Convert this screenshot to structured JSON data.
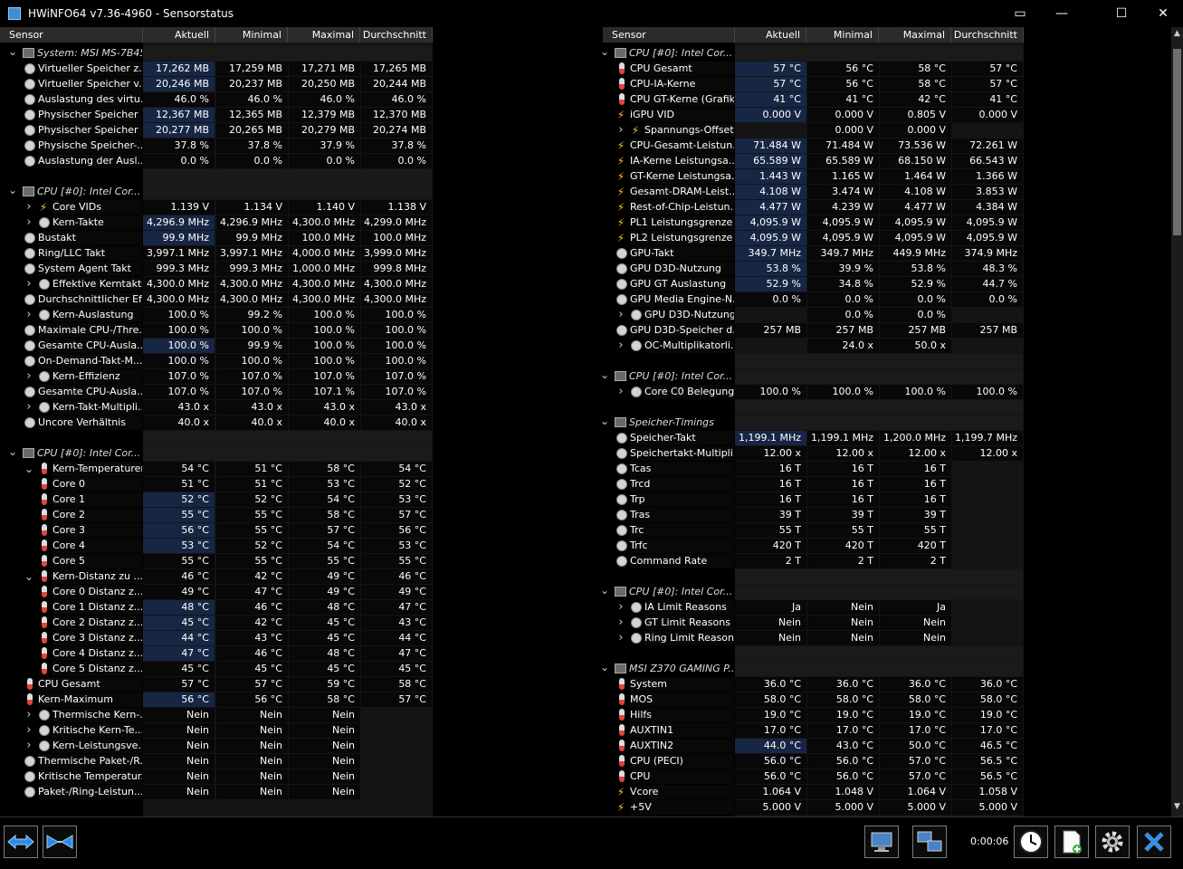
{
  "window": {
    "title": "HWiNFO64 v7.36-4960 - Sensorstatus",
    "min": "—",
    "max": "☐",
    "close": "✕"
  },
  "columns": {
    "sensor": "Sensor",
    "current": "Aktuell",
    "min": "Minimal",
    "max": "Maximal",
    "avg": "Durchschnitt"
  },
  "left": [
    {
      "t": "g",
      "n": "System: MSI MS-7B45",
      "i": "chip"
    },
    {
      "n": "Virtueller Speicher z...",
      "i": "clock",
      "v": [
        "17,262 MB",
        "17,259 MB",
        "17,271 MB",
        "17,265 MB"
      ],
      "h": 1
    },
    {
      "n": "Virtueller Speicher v...",
      "i": "clock",
      "v": [
        "20,246 MB",
        "20,237 MB",
        "20,250 MB",
        "20,244 MB"
      ],
      "h": 1
    },
    {
      "n": "Auslastung des virtu...",
      "i": "clock",
      "v": [
        "46.0 %",
        "46.0 %",
        "46.0 %",
        "46.0 %"
      ]
    },
    {
      "n": "Physischer Speicher ...",
      "i": "clock",
      "v": [
        "12,367 MB",
        "12,365 MB",
        "12,379 MB",
        "12,370 MB"
      ],
      "h": 1
    },
    {
      "n": "Physischer Speicher ...",
      "i": "clock",
      "v": [
        "20,277 MB",
        "20,265 MB",
        "20,279 MB",
        "20,274 MB"
      ],
      "h": 1
    },
    {
      "n": "Physische Speicher-...",
      "i": "clock",
      "v": [
        "37.8 %",
        "37.8 %",
        "37.9 %",
        "37.8 %"
      ]
    },
    {
      "n": "Auslastung der Ausl...",
      "i": "clock",
      "v": [
        "0.0 %",
        "0.0 %",
        "0.0 %",
        "0.0 %"
      ]
    },
    {
      "t": "b"
    },
    {
      "t": "g",
      "n": "CPU [#0]: Intel Cor...",
      "i": "chip"
    },
    {
      "n": "Core VIDs",
      "i": "bolt",
      "x": 1,
      "v": [
        "1.139 V",
        "1.134 V",
        "1.140 V",
        "1.138 V"
      ]
    },
    {
      "n": "Kern-Takte",
      "i": "clock",
      "x": 1,
      "v": [
        "4,296.9 MHz",
        "4,296.9 MHz",
        "4,300.0 MHz",
        "4,299.0 MHz"
      ],
      "h": 1
    },
    {
      "n": "Bustakt",
      "i": "clock",
      "v": [
        "99.9 MHz",
        "99.9 MHz",
        "100.0 MHz",
        "100.0 MHz"
      ],
      "h": 1
    },
    {
      "n": "Ring/LLC Takt",
      "i": "clock",
      "v": [
        "3,997.1 MHz",
        "3,997.1 MHz",
        "4,000.0 MHz",
        "3,999.0 MHz"
      ]
    },
    {
      "n": "System Agent Takt",
      "i": "clock",
      "v": [
        "999.3 MHz",
        "999.3 MHz",
        "1,000.0 MHz",
        "999.8 MHz"
      ]
    },
    {
      "n": "Effektive Kerntakte",
      "i": "clock",
      "x": 1,
      "v": [
        "4,300.0 MHz",
        "4,300.0 MHz",
        "4,300.0 MHz",
        "4,300.0 MHz"
      ]
    },
    {
      "n": "Durchschnittlicher Ef...",
      "i": "clock",
      "v": [
        "4,300.0 MHz",
        "4,300.0 MHz",
        "4,300.0 MHz",
        "4,300.0 MHz"
      ]
    },
    {
      "n": "Kern-Auslastung",
      "i": "clock",
      "x": 1,
      "v": [
        "100.0 %",
        "99.2 %",
        "100.0 %",
        "100.0 %"
      ]
    },
    {
      "n": "Maximale CPU-/Thre...",
      "i": "clock",
      "v": [
        "100.0 %",
        "100.0 %",
        "100.0 %",
        "100.0 %"
      ]
    },
    {
      "n": "Gesamte CPU-Ausla...",
      "i": "clock",
      "v": [
        "100.0 %",
        "99.9 %",
        "100.0 %",
        "100.0 %"
      ],
      "h": 1
    },
    {
      "n": "On-Demand-Takt-M...",
      "i": "clock",
      "v": [
        "100.0 %",
        "100.0 %",
        "100.0 %",
        "100.0 %"
      ]
    },
    {
      "n": "Kern-Effizienz",
      "i": "clock",
      "x": 1,
      "v": [
        "107.0 %",
        "107.0 %",
        "107.0 %",
        "107.0 %"
      ]
    },
    {
      "n": "Gesamte CPU-Ausla...",
      "i": "clock",
      "v": [
        "107.0 %",
        "107.0 %",
        "107.1 %",
        "107.0 %"
      ]
    },
    {
      "n": "Kern-Takt-Multipli...",
      "i": "clock",
      "x": 1,
      "v": [
        "43.0 x",
        "43.0 x",
        "43.0 x",
        "43.0 x"
      ]
    },
    {
      "n": "Uncore Verhältnis",
      "i": "clock",
      "v": [
        "40.0 x",
        "40.0 x",
        "40.0 x",
        "40.0 x"
      ]
    },
    {
      "t": "b"
    },
    {
      "t": "g",
      "n": "CPU [#0]: Intel Cor...",
      "i": "chip"
    },
    {
      "n": "Kern-Temperaturen",
      "i": "therm",
      "x": 2,
      "v": [
        "54 °C",
        "51 °C",
        "58 °C",
        "54 °C"
      ]
    },
    {
      "n": "Core 0",
      "i": "therm",
      "s": 1,
      "v": [
        "51 °C",
        "51 °C",
        "53 °C",
        "52 °C"
      ]
    },
    {
      "n": "Core 1",
      "i": "therm",
      "s": 1,
      "v": [
        "52 °C",
        "52 °C",
        "54 °C",
        "53 °C"
      ],
      "h": 1
    },
    {
      "n": "Core 2",
      "i": "therm",
      "s": 1,
      "v": [
        "55 °C",
        "55 °C",
        "58 °C",
        "57 °C"
      ],
      "h": 1
    },
    {
      "n": "Core 3",
      "i": "therm",
      "s": 1,
      "v": [
        "56 °C",
        "55 °C",
        "57 °C",
        "56 °C"
      ],
      "h": 1
    },
    {
      "n": "Core 4",
      "i": "therm",
      "s": 1,
      "v": [
        "53 °C",
        "52 °C",
        "54 °C",
        "53 °C"
      ],
      "h": 1
    },
    {
      "n": "Core 5",
      "i": "therm",
      "s": 1,
      "v": [
        "55 °C",
        "55 °C",
        "55 °C",
        "55 °C"
      ]
    },
    {
      "n": "Kern-Distanz zu ...",
      "i": "therm",
      "x": 2,
      "v": [
        "46 °C",
        "42 °C",
        "49 °C",
        "46 °C"
      ]
    },
    {
      "n": "Core 0 Distanz z...",
      "i": "therm",
      "s": 1,
      "v": [
        "49 °C",
        "47 °C",
        "49 °C",
        "49 °C"
      ]
    },
    {
      "n": "Core 1 Distanz z...",
      "i": "therm",
      "s": 1,
      "v": [
        "48 °C",
        "46 °C",
        "48 °C",
        "47 °C"
      ],
      "h": 1
    },
    {
      "n": "Core 2 Distanz z...",
      "i": "therm",
      "s": 1,
      "v": [
        "45 °C",
        "42 °C",
        "45 °C",
        "43 °C"
      ],
      "h": 1
    },
    {
      "n": "Core 3 Distanz z...",
      "i": "therm",
      "s": 1,
      "v": [
        "44 °C",
        "43 °C",
        "45 °C",
        "44 °C"
      ],
      "h": 1
    },
    {
      "n": "Core 4 Distanz z...",
      "i": "therm",
      "s": 1,
      "v": [
        "47 °C",
        "46 °C",
        "48 °C",
        "47 °C"
      ],
      "h": 1
    },
    {
      "n": "Core 5 Distanz z...",
      "i": "therm",
      "s": 1,
      "v": [
        "45 °C",
        "45 °C",
        "45 °C",
        "45 °C"
      ]
    },
    {
      "n": "CPU Gesamt",
      "i": "therm",
      "v": [
        "57 °C",
        "57 °C",
        "59 °C",
        "58 °C"
      ]
    },
    {
      "n": "Kern-Maximum",
      "i": "therm",
      "v": [
        "56 °C",
        "56 °C",
        "58 °C",
        "57 °C"
      ],
      "h": 1
    },
    {
      "n": "Thermische Kern-...",
      "i": "clock",
      "x": 1,
      "v": [
        "Nein",
        "Nein",
        "Nein",
        ""
      ]
    },
    {
      "n": "Kritische Kern-Te...",
      "i": "clock",
      "x": 1,
      "v": [
        "Nein",
        "Nein",
        "Nein",
        ""
      ]
    },
    {
      "n": "Kern-Leistungsve...",
      "i": "clock",
      "x": 1,
      "v": [
        "Nein",
        "Nein",
        "Nein",
        ""
      ]
    },
    {
      "n": "Thermische Paket-/R...",
      "i": "clock",
      "v": [
        "Nein",
        "Nein",
        "Nein",
        ""
      ]
    },
    {
      "n": "Kritische Temperatur...",
      "i": "clock",
      "v": [
        "Nein",
        "Nein",
        "Nein",
        ""
      ]
    },
    {
      "n": "Paket-/Ring-Leistun...",
      "i": "clock",
      "v": [
        "Nein",
        "Nein",
        "Nein",
        ""
      ]
    }
  ],
  "right": [
    {
      "t": "g",
      "n": "CPU [#0]: Intel Cor...",
      "i": "chip"
    },
    {
      "n": "CPU Gesamt",
      "i": "therm",
      "v": [
        "57 °C",
        "56 °C",
        "58 °C",
        "57 °C"
      ],
      "h": 1
    },
    {
      "n": "CPU-IA-Kerne",
      "i": "therm",
      "v": [
        "57 °C",
        "56 °C",
        "58 °C",
        "57 °C"
      ],
      "h": 1
    },
    {
      "n": "CPU GT-Kerne (Grafik)",
      "i": "therm",
      "v": [
        "41 °C",
        "41 °C",
        "42 °C",
        "41 °C"
      ],
      "h": 1
    },
    {
      "n": "iGPU VID",
      "i": "bolt",
      "v": [
        "0.000 V",
        "0.000 V",
        "0.805 V",
        "0.000 V"
      ],
      "h": 1
    },
    {
      "n": "Spannungs-Offsets",
      "i": "bolt",
      "x": 1,
      "v": [
        "",
        "0.000 V",
        "0.000 V",
        ""
      ]
    },
    {
      "n": "CPU-Gesamt-Leistun...",
      "i": "bolt",
      "v": [
        "71.484 W",
        "71.484 W",
        "73.536 W",
        "72.261 W"
      ],
      "h": 1
    },
    {
      "n": "IA-Kerne Leistungsa...",
      "i": "bolt",
      "v": [
        "65.589 W",
        "65.589 W",
        "68.150 W",
        "66.543 W"
      ],
      "h": 1
    },
    {
      "n": "GT-Kerne Leistungsa...",
      "i": "bolt",
      "v": [
        "1.443 W",
        "1.165 W",
        "1.464 W",
        "1.366 W"
      ],
      "h": 1
    },
    {
      "n": "Gesamt-DRAM-Leist...",
      "i": "bolt",
      "v": [
        "4.108 W",
        "3.474 W",
        "4.108 W",
        "3.853 W"
      ],
      "h": 1
    },
    {
      "n": "Rest-of-Chip-Leistun...",
      "i": "bolt",
      "v": [
        "4.477 W",
        "4.239 W",
        "4.477 W",
        "4.384 W"
      ],
      "h": 1
    },
    {
      "n": "PL1 Leistungsgrenze",
      "i": "bolt",
      "v": [
        "4,095.9 W",
        "4,095.9 W",
        "4,095.9 W",
        "4,095.9 W"
      ],
      "h": 1
    },
    {
      "n": "PL2 Leistungsgrenze",
      "i": "bolt",
      "v": [
        "4,095.9 W",
        "4,095.9 W",
        "4,095.9 W",
        "4,095.9 W"
      ],
      "h": 1
    },
    {
      "n": "GPU-Takt",
      "i": "clock",
      "v": [
        "349.7 MHz",
        "349.7 MHz",
        "449.9 MHz",
        "374.9 MHz"
      ],
      "h": 1
    },
    {
      "n": "GPU D3D-Nutzung",
      "i": "clock",
      "v": [
        "53.8 %",
        "39.9 %",
        "53.8 %",
        "48.3 %"
      ],
      "h": 1
    },
    {
      "n": "GPU GT Auslastung",
      "i": "clock",
      "v": [
        "52.9 %",
        "34.8 %",
        "52.9 %",
        "44.7 %"
      ],
      "h": 1
    },
    {
      "n": "GPU Media Engine-N...",
      "i": "clock",
      "v": [
        "0.0 %",
        "0.0 %",
        "0.0 %",
        "0.0 %"
      ]
    },
    {
      "n": "GPU D3D-Nutzung",
      "i": "clock",
      "x": 1,
      "v": [
        "",
        "0.0 %",
        "0.0 %",
        ""
      ]
    },
    {
      "n": "GPU D3D-Speicher d...",
      "i": "clock",
      "v": [
        "257 MB",
        "257 MB",
        "257 MB",
        "257 MB"
      ]
    },
    {
      "n": "OC-Multiplikatorli...",
      "i": "clock",
      "x": 1,
      "v": [
        "",
        "24.0 x",
        "50.0 x",
        ""
      ]
    },
    {
      "t": "b"
    },
    {
      "t": "g",
      "n": "CPU [#0]: Intel Cor...",
      "i": "chip"
    },
    {
      "n": "Core C0 Belegung",
      "i": "clock",
      "x": 1,
      "v": [
        "100.0 %",
        "100.0 %",
        "100.0 %",
        "100.0 %"
      ]
    },
    {
      "t": "b"
    },
    {
      "t": "g",
      "n": "Speicher-Timings",
      "i": "chip"
    },
    {
      "n": "Speicher-Takt",
      "i": "clock",
      "v": [
        "1,199.1 MHz",
        "1,199.1 MHz",
        "1,200.0 MHz",
        "1,199.7 MHz"
      ],
      "h": 1
    },
    {
      "n": "Speichertakt-Multipli...",
      "i": "clock",
      "v": [
        "12.00 x",
        "12.00 x",
        "12.00 x",
        "12.00 x"
      ]
    },
    {
      "n": "Tcas",
      "i": "clock",
      "v": [
        "16 T",
        "16 T",
        "16 T",
        ""
      ]
    },
    {
      "n": "Trcd",
      "i": "clock",
      "v": [
        "16 T",
        "16 T",
        "16 T",
        ""
      ]
    },
    {
      "n": "Trp",
      "i": "clock",
      "v": [
        "16 T",
        "16 T",
        "16 T",
        ""
      ]
    },
    {
      "n": "Tras",
      "i": "clock",
      "v": [
        "39 T",
        "39 T",
        "39 T",
        ""
      ]
    },
    {
      "n": "Trc",
      "i": "clock",
      "v": [
        "55 T",
        "55 T",
        "55 T",
        ""
      ]
    },
    {
      "n": "Trfc",
      "i": "clock",
      "v": [
        "420 T",
        "420 T",
        "420 T",
        ""
      ]
    },
    {
      "n": "Command Rate",
      "i": "clock",
      "v": [
        "2 T",
        "2 T",
        "2 T",
        ""
      ]
    },
    {
      "t": "b"
    },
    {
      "t": "g",
      "n": "CPU [#0]: Intel Cor...",
      "i": "chip"
    },
    {
      "n": "IA Limit Reasons",
      "i": "clock",
      "x": 1,
      "v": [
        "Ja",
        "Nein",
        "Ja",
        ""
      ]
    },
    {
      "n": "GT Limit Reasons",
      "i": "clock",
      "x": 1,
      "v": [
        "Nein",
        "Nein",
        "Nein",
        ""
      ]
    },
    {
      "n": "Ring Limit Reasons",
      "i": "clock",
      "x": 1,
      "v": [
        "Nein",
        "Nein",
        "Nein",
        ""
      ]
    },
    {
      "t": "b"
    },
    {
      "t": "g",
      "n": "MSI Z370 GAMING P...",
      "i": "chip"
    },
    {
      "n": "System",
      "i": "therm",
      "v": [
        "36.0 °C",
        "36.0 °C",
        "36.0 °C",
        "36.0 °C"
      ]
    },
    {
      "n": "MOS",
      "i": "therm",
      "v": [
        "58.0 °C",
        "58.0 °C",
        "58.0 °C",
        "58.0 °C"
      ]
    },
    {
      "n": "Hilfs",
      "i": "therm",
      "v": [
        "19.0 °C",
        "19.0 °C",
        "19.0 °C",
        "19.0 °C"
      ]
    },
    {
      "n": "AUXTIN1",
      "i": "therm",
      "v": [
        "17.0 °C",
        "17.0 °C",
        "17.0 °C",
        "17.0 °C"
      ]
    },
    {
      "n": "AUXTIN2",
      "i": "therm",
      "v": [
        "44.0 °C",
        "43.0 °C",
        "50.0 °C",
        "46.5 °C"
      ],
      "h": 1
    },
    {
      "n": "CPU (PECI)",
      "i": "therm",
      "v": [
        "56.0 °C",
        "56.0 °C",
        "57.0 °C",
        "56.5 °C"
      ]
    },
    {
      "n": "CPU",
      "i": "therm",
      "v": [
        "56.0 °C",
        "56.0 °C",
        "57.0 °C",
        "56.5 °C"
      ]
    },
    {
      "n": "Vcore",
      "i": "bolt",
      "v": [
        "1.064 V",
        "1.048 V",
        "1.064 V",
        "1.058 V"
      ]
    },
    {
      "n": "+5V",
      "i": "bolt",
      "v": [
        "5.000 V",
        "5.000 V",
        "5.000 V",
        "5.000 V"
      ]
    }
  ],
  "bottom": {
    "timer": "0:00:06"
  }
}
